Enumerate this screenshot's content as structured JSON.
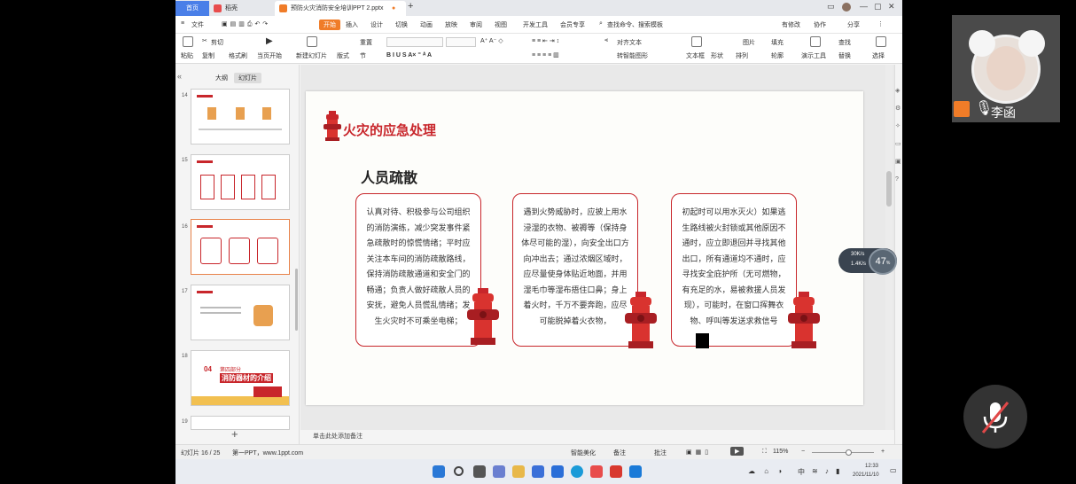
{
  "tabs": {
    "home": "首页",
    "docer": "稻壳",
    "document": "预防火灾消防安全培训PPT 2.pptx"
  },
  "menu": {
    "file": "文件",
    "items": [
      "开始",
      "插入",
      "设计",
      "切换",
      "动画",
      "放映",
      "审阅",
      "视图",
      "开发工具",
      "会员专享"
    ],
    "search": "查找命令、搜索模板",
    "unsaved": "有修改",
    "collab": "协作",
    "share": "分享"
  },
  "ribbon": {
    "paste": "粘贴",
    "cut": "剪切",
    "copy": "复制",
    "format_painter": "格式刷",
    "from_current": "当页开始",
    "new_slide": "新建幻灯片",
    "layout": "版式",
    "section": "节",
    "reset": "重置",
    "text_box": "文本框",
    "shape": "形状",
    "arrange": "排列",
    "picture": "图片",
    "fill": "填充",
    "outline": "轮廓",
    "presentation_tools": "演示工具",
    "find": "查找",
    "replace": "替换",
    "select": "选择",
    "align_text": "对齐文本",
    "smart_shape": "转智能图形"
  },
  "left_panel": {
    "tab_outline": "大纲",
    "tab_slides": "幻灯片",
    "thumb_numbers": [
      "14",
      "15",
      "16",
      "17",
      "18",
      "19"
    ],
    "thumb18_num": "04",
    "thumb18_part": "第四部分",
    "thumb18_title": "消防器材的介绍"
  },
  "slide": {
    "title": "火灾的应急处理",
    "subtitle": "人员疏散",
    "card1": "认真对待、积极参与公司组织的消防演练，减少突发事件紧急疏散时的惊慌情绪；平时应关注本车间的消防疏散路线，保持消防疏散通道和安全门的畅通；负责人做好疏散人员的安抚，避免人员慌乱情绪；发生火灾时不可乘坐电梯；",
    "card2": "遇到火势威胁时，应披上用水浸湿的衣物、被褥等（保持身体尽可能的湿），向安全出口方向冲出去；通过浓烟区域时，应尽量使身体贴近地面，并用湿毛巾等湿布捂住口鼻；身上着火时，千万不要奔跑，应尽可能脱掉着火衣物，",
    "card3": "初起时可以用水灭火）如果逃生路线被火封锁或其他原因不通时，应立即退回并寻找其他出口，所有通道均不通时，应寻找安全庇护所（无可燃物，有充足的水，易被救援人员发现），可能时，在窗口挥舞衣物、呼叫等发送求救信号"
  },
  "notes": "单击此处添加备注",
  "status": {
    "slide_no": "幻灯片 16 / 25",
    "theme": "第一PPT，www.1ppt.com",
    "smart_beautify": "智能美化",
    "notes": "备注",
    "comments": "批注",
    "zoom": "115%"
  },
  "taskbar": {
    "time": "12:33",
    "date": "2021/11/10",
    "ime": "中"
  },
  "network": {
    "up": "30K/s",
    "down": "1.4K/s",
    "percent": "47",
    "percent_unit": "%"
  },
  "video": {
    "name": "李函"
  },
  "colors": {
    "accent_red": "#c8262b",
    "wps_orange": "#f07c28",
    "home_tab_blue": "#4a7fe8"
  }
}
